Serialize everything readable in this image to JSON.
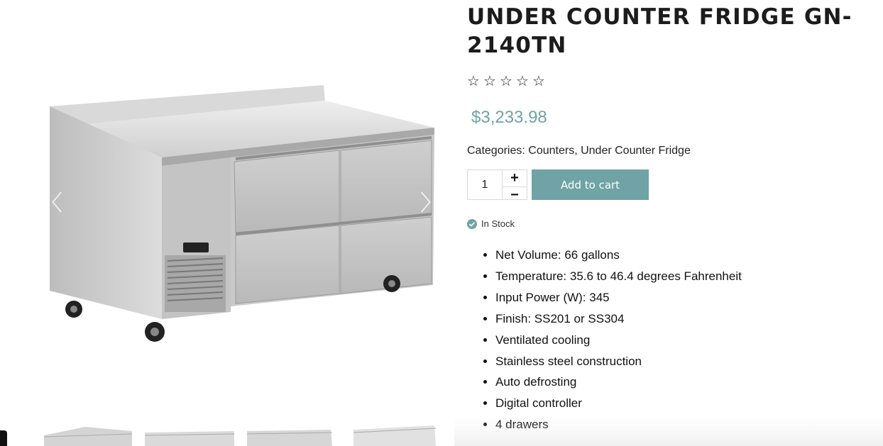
{
  "product": {
    "title": "UNDER COUNTER FRIDGE GN-2140TN",
    "rating_stars": [
      "☆",
      "☆",
      "☆",
      "☆",
      "☆"
    ],
    "price": "$3,233.98",
    "categories_label": "Categories:",
    "categories": [
      "Counters",
      "Under Counter Fridge"
    ],
    "quantity": "1",
    "add_to_cart": "Add to cart",
    "stock_status": "In Stock",
    "features": [
      "Net Volume: 66 gallons",
      "Temperature: 35.6 to 46.4 degrees Fahrenheit",
      "Input Power (W): 345",
      "Finish: SS201 or SS304",
      "Ventilated cooling",
      "Stainless steel construction",
      "Auto defrosting",
      "Digital controller",
      "4 drawers"
    ]
  },
  "gallery": {
    "thumbnail_count": 4
  },
  "colors": {
    "accent": "#6fa3a5",
    "text": "#222222"
  },
  "icons": {
    "prev": "chevron-left-icon",
    "next": "chevron-right-icon",
    "stock": "check-circle-icon",
    "plus": "plus-icon",
    "minus": "minus-icon"
  }
}
